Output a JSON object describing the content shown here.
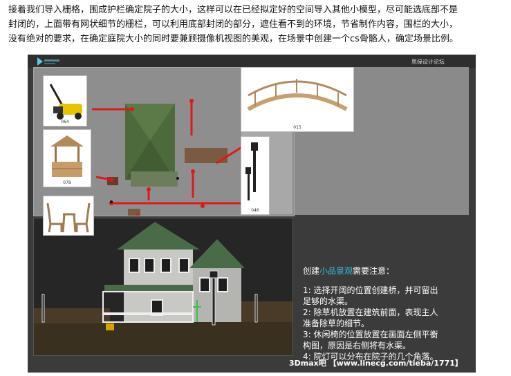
{
  "paragraph": {
    "line1": "接着我们导入栅格，围成护栏确定院子的大小，这样可以在已经拟定好的空间导入其他小模型，尽可能选底部不是",
    "line2": "封闭的，上面带有网状细节的栅栏，可以利用底部封闭的部分，遮住看不到的环境，节省制作内容，围栏的大小，",
    "line3": "没有绝对的要求，在确定庭院大小的同时要兼顾摄像机视图的美观，在场景中创建一个cs骨骼人，确定场景比例。"
  },
  "panel": {
    "watermark": "思缘设计论坛",
    "thumb_captions": {
      "mower": "064",
      "well": "078",
      "bridge": "015",
      "lamp": "046"
    },
    "notes": {
      "heading_prefix": "创建",
      "heading_highlight": "小品景观",
      "heading_suffix": "需要注意：",
      "item1a": "1: 选择开阔的位置创建桥，并可留出",
      "item1b": "足够的水渠。",
      "item2a": "2: 除草机放置在建筑前面，表现主人",
      "item2b": "准备除草的细节。",
      "item3a": "3: 休闲椅的位置放置在画面左侧平衡",
      "item3b": "构图，原因是右侧将有水渠。",
      "item4": "4: 院灯可以分布在院子的几个角落。"
    },
    "footer": "3Dmax吧 【www.linecg.com/tieba/1771】"
  },
  "colors": {
    "panel_bg": "#3b3b3b",
    "highlight": "#2fc0e0",
    "connector": "#e01818"
  }
}
